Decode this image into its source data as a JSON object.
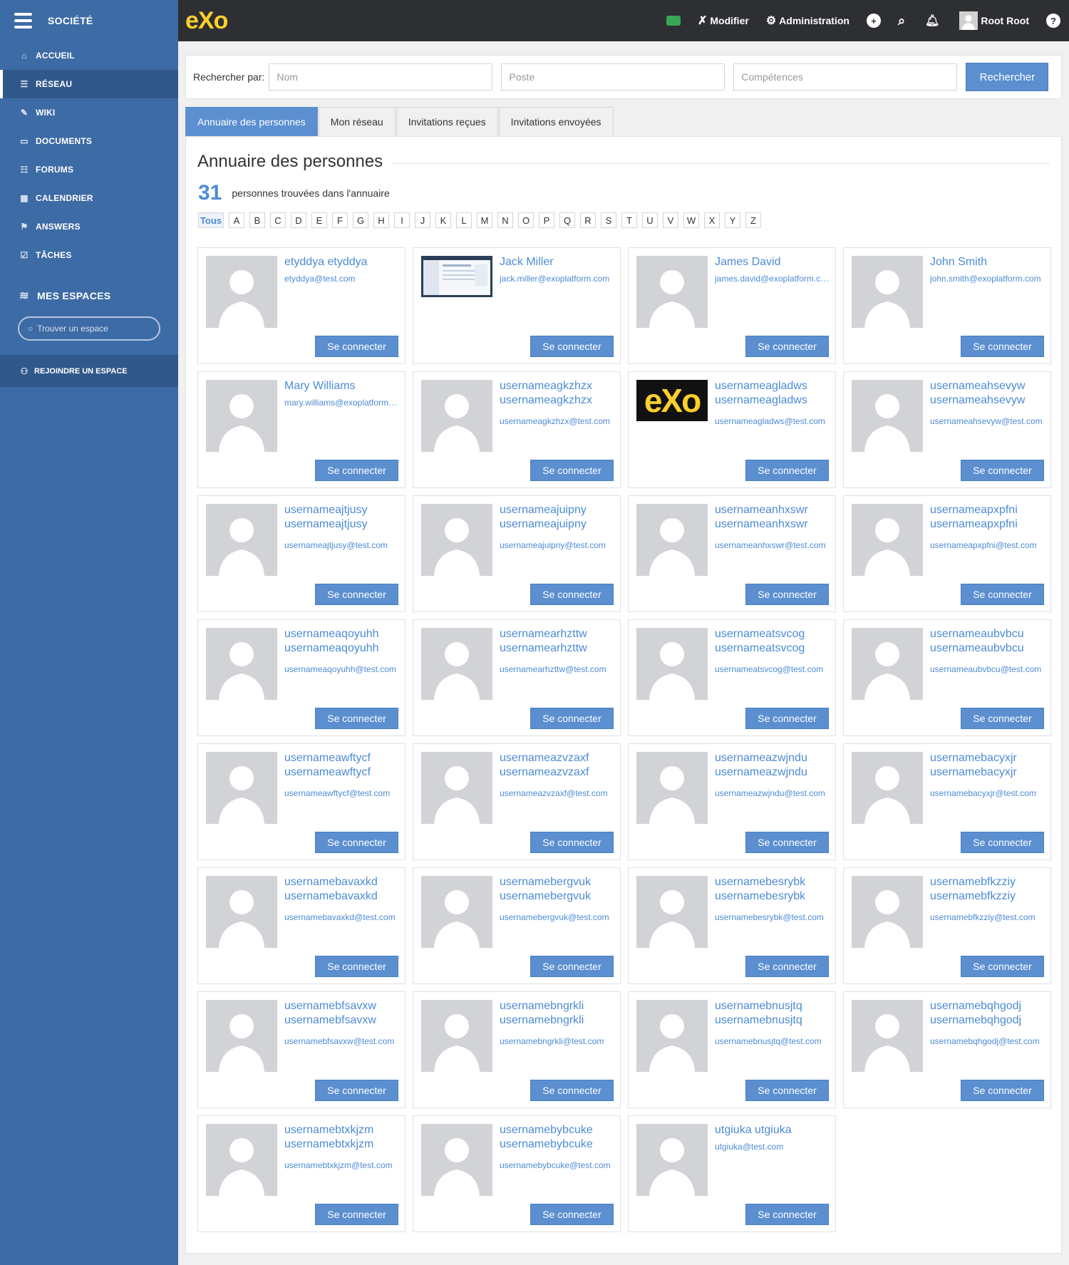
{
  "sidebar": {
    "brand": "SOCIÉTÉ",
    "items": [
      {
        "label": "ACCUEIL",
        "icon": "home-icon",
        "glyph": "⌂",
        "active": false
      },
      {
        "label": "RÉSEAU",
        "icon": "network-icon",
        "glyph": "☰",
        "active": true
      },
      {
        "label": "WIKI",
        "icon": "wiki-icon",
        "glyph": "✎",
        "active": false
      },
      {
        "label": "DOCUMENTS",
        "icon": "folder-icon",
        "glyph": "▭",
        "active": false
      },
      {
        "label": "FORUMS",
        "icon": "forum-icon",
        "glyph": "☷",
        "active": false
      },
      {
        "label": "CALENDRIER",
        "icon": "calendar-icon",
        "glyph": "▦",
        "active": false
      },
      {
        "label": "ANSWERS",
        "icon": "answers-icon",
        "glyph": "⚑",
        "active": false
      },
      {
        "label": "TÂCHES",
        "icon": "tasks-icon",
        "glyph": "☑",
        "active": false
      }
    ],
    "spaces_title": "MES ESPACES",
    "search_placeholder": "Trouver un espace",
    "join_label": "REJOINDRE UN ESPACE"
  },
  "topbar": {
    "logo": "eXo",
    "edit_label": "Modifier",
    "admin_label": "Administration",
    "user_name": "Root Root",
    "colors": {
      "chat": "#3aa655",
      "logo": "#ffd02a"
    }
  },
  "search": {
    "label": "Rechercher par:",
    "name_placeholder": "Nom",
    "position_placeholder": "Poste",
    "skills_placeholder": "Compétences",
    "button": "Rechercher"
  },
  "tabs": [
    {
      "label": "Annuaire des personnes",
      "active": true
    },
    {
      "label": "Mon réseau",
      "active": false
    },
    {
      "label": "Invitations reçues",
      "active": false
    },
    {
      "label": "Invitations envoyées",
      "active": false
    }
  ],
  "directory": {
    "title": "Annuaire des personnes",
    "count": "31",
    "count_text": "personnes trouvées dans l'annuaire",
    "letters": [
      "Tous",
      "A",
      "B",
      "C",
      "D",
      "E",
      "F",
      "G",
      "H",
      "I",
      "J",
      "K",
      "L",
      "M",
      "N",
      "O",
      "P",
      "Q",
      "R",
      "S",
      "T",
      "U",
      "V",
      "W",
      "X",
      "Y",
      "Z"
    ],
    "connect_label": "Se connecter",
    "people": [
      {
        "name": "etyddya etyddya",
        "email": "etyddya@test.com",
        "avatar": "default"
      },
      {
        "name": "Jack Miller",
        "email": "jack.miller@exoplatform.com",
        "avatar": "screenshot"
      },
      {
        "name": "James David",
        "email": "james.david@exoplatform.com",
        "avatar": "default"
      },
      {
        "name": "John Smith",
        "email": "john.smith@exoplatform.com",
        "avatar": "default"
      },
      {
        "name": "Mary Williams",
        "email": "mary.williams@exoplatform.com",
        "avatar": "default"
      },
      {
        "name": "usernameagkzhzx usernameagkzhzx",
        "email": "usernameagkzhzx@test.com",
        "avatar": "default"
      },
      {
        "name": "usernameagladws usernameagladws",
        "email": "usernameagladws@test.com",
        "avatar": "exo"
      },
      {
        "name": "usernameahsevyw usernameahsevyw",
        "email": "usernameahsevyw@test.com",
        "avatar": "default"
      },
      {
        "name": "usernameajtjusy usernameajtjusy",
        "email": "usernameajtjusy@test.com",
        "avatar": "default"
      },
      {
        "name": "usernameajuipny usernameajuipny",
        "email": "usernameajuipny@test.com",
        "avatar": "default"
      },
      {
        "name": "usernameanhxswr usernameanhxswr",
        "email": "usernameanhxswr@test.com",
        "avatar": "default"
      },
      {
        "name": "usernameapxpfni usernameapxpfni",
        "email": "usernameapxpfni@test.com",
        "avatar": "default"
      },
      {
        "name": "usernameaqoyuhh usernameaqoyuhh",
        "email": "usernameaqoyuhh@test.com",
        "avatar": "default"
      },
      {
        "name": "usernamearhzttw usernamearhzttw",
        "email": "usernamearhzttw@test.com",
        "avatar": "default"
      },
      {
        "name": "usernameatsvcog usernameatsvcog",
        "email": "usernameatsvcog@test.com",
        "avatar": "default"
      },
      {
        "name": "usernameaubvbcu usernameaubvbcu",
        "email": "usernameaubvbcu@test.com",
        "avatar": "default"
      },
      {
        "name": "usernameawftycf usernameawftycf",
        "email": "usernameawftycf@test.com",
        "avatar": "default"
      },
      {
        "name": "usernameazvzaxf usernameazvzaxf",
        "email": "usernameazvzaxf@test.com",
        "avatar": "default"
      },
      {
        "name": "usernameazwjndu usernameazwjndu",
        "email": "usernameazwjndu@test.com",
        "avatar": "default"
      },
      {
        "name": "usernamebacyxjr usernamebacyxjr",
        "email": "usernamebacyxjr@test.com",
        "avatar": "default"
      },
      {
        "name": "usernamebavaxkd usernamebavaxkd",
        "email": "usernamebavaxkd@test.com",
        "avatar": "default"
      },
      {
        "name": "usernamebergvuk usernamebergvuk",
        "email": "usernamebergvuk@test.com",
        "avatar": "default"
      },
      {
        "name": "usernamebesrybk usernamebesrybk",
        "email": "usernamebesrybk@test.com",
        "avatar": "default"
      },
      {
        "name": "usernamebfkzziy usernamebfkzziy",
        "email": "usernamebfkzziy@test.com",
        "avatar": "default"
      },
      {
        "name": "usernamebfsavxw usernamebfsavxw",
        "email": "usernamebfsavxw@test.com",
        "avatar": "default"
      },
      {
        "name": "usernamebngrkli usernamebngrkli",
        "email": "usernamebngrkli@test.com",
        "avatar": "default"
      },
      {
        "name": "usernamebnusjtq usernamebnusjtq",
        "email": "usernamebnusjtq@test.com",
        "avatar": "default"
      },
      {
        "name": "usernamebqhgodj usernamebqhgodj",
        "email": "usernamebqhgodj@test.com",
        "avatar": "default"
      },
      {
        "name": "usernamebtxkjzm usernamebtxkjzm",
        "email": "usernamebtxkjzm@test.com",
        "avatar": "default"
      },
      {
        "name": "usernamebybcuke usernamebybcuke",
        "email": "usernamebybcuke@test.com",
        "avatar": "default"
      },
      {
        "name": "utgiuka utgiuka",
        "email": "utgiuka@test.com",
        "avatar": "default"
      }
    ]
  }
}
